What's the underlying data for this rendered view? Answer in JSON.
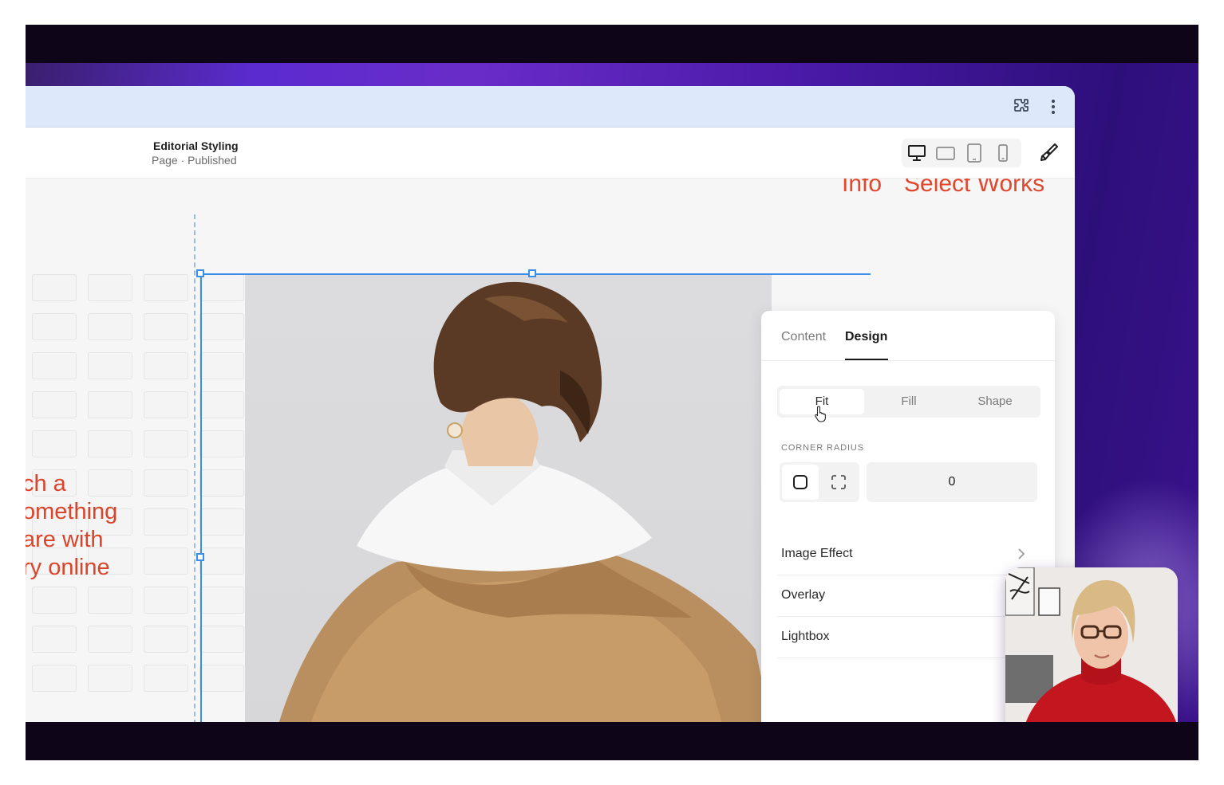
{
  "browser": {
    "toolbar_icons": [
      "extensions-icon",
      "more-vertical-icon"
    ]
  },
  "editor": {
    "page_title": "Editorial Styling",
    "page_status": "Page · Published",
    "devices": [
      "desktop-icon",
      "tablet-landscape-icon",
      "tablet-portrait-icon",
      "phone-icon"
    ],
    "style_tool": "paintbrush-icon"
  },
  "canvas": {
    "nav": [
      "Info",
      "Select Works"
    ],
    "left_text": [
      "ch a",
      "omething",
      "are with",
      "ry online"
    ],
    "accent_color": "#e0482e",
    "selection_color": "#3a8ee6"
  },
  "panel": {
    "tabs": [
      {
        "label": "Content",
        "active": false
      },
      {
        "label": "Design",
        "active": true
      }
    ],
    "fit_options": [
      {
        "label": "Fit",
        "active": true
      },
      {
        "label": "Fill",
        "active": false
      },
      {
        "label": "Shape",
        "active": false
      }
    ],
    "corner_radius_label": "CORNER RADIUS",
    "corner_radius_value": "0",
    "rows": [
      "Image Effect",
      "Overlay",
      "Lightbox"
    ]
  }
}
